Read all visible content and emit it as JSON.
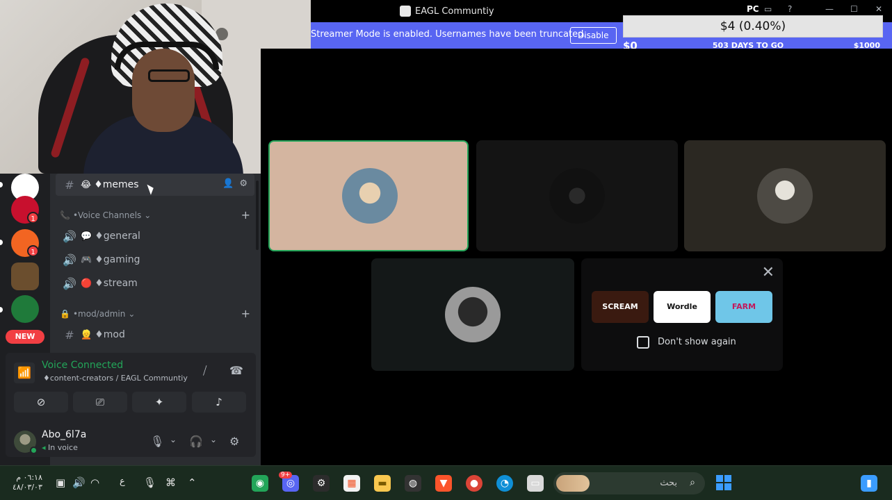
{
  "window": {
    "title": "EAGL Communtiy",
    "pc_label": "PC",
    "minimize": "—",
    "maximize": "☐",
    "close": "✕"
  },
  "banner": {
    "text": "Streamer Mode is enabled. Usernames have been truncated.",
    "disable_label": "Disable"
  },
  "donation_goal": {
    "amount": "$4 (0.40%)",
    "min": "$0",
    "days": "503 DAYS TO GO",
    "max": "$1000",
    "progress_percent": 0.4
  },
  "servers": [
    {
      "name": "server-kee",
      "badge": "",
      "color": "#ffffff"
    },
    {
      "name": "server-m",
      "badge": "1",
      "color": "#c8102e"
    },
    {
      "name": "server-orange",
      "badge": "1",
      "color": "#f26522"
    },
    {
      "name": "server-thv",
      "badge": "",
      "color": "#6b4e2e"
    },
    {
      "name": "server-green",
      "badge": "",
      "color": "#1f7a3a"
    }
  ],
  "new_label": "NEW",
  "channels": {
    "memes": {
      "emoji": "😂",
      "name": "♦memes"
    },
    "voice_category": "•Voice Channels",
    "general": {
      "emoji": "💬",
      "name": "♦general"
    },
    "gaming": {
      "emoji": "🎮",
      "name": "♦gaming"
    },
    "stream": {
      "emoji": "🔴",
      "name": "♦stream"
    },
    "mod_category": "•mod/admin",
    "mod": {
      "emoji": "👱",
      "name": "♦mod"
    }
  },
  "voice": {
    "status": "Voice Connected",
    "location": "♦content-creators / EAGL Communtiy"
  },
  "user": {
    "name": "Abo_6l7a",
    "status": "In voice"
  },
  "activity": {
    "games": [
      {
        "label": "SCREAM",
        "bg": "#3a1a10",
        "fg": "#ffffff"
      },
      {
        "label": "Wordle",
        "bg": "#ffffff",
        "fg": "#111111"
      },
      {
        "label": "FARM",
        "bg": "#6fc6e8",
        "fg": "#c2185b"
      }
    ],
    "dont_show": "Don't show again"
  },
  "taskbar": {
    "time": "٠٦:١٨ م",
    "date": "٤٨/٠٣/٠٣",
    "lang": "ع",
    "search_placeholder": "بحث",
    "discord_badge": "9+"
  },
  "colors": {
    "accent": "#5865f2",
    "green": "#23a559",
    "red": "#f23f43"
  }
}
